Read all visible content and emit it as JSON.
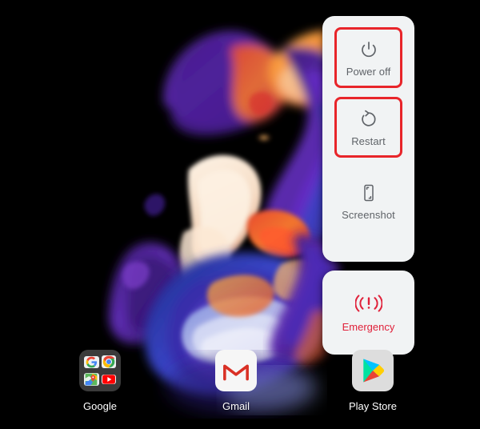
{
  "screen": {
    "background_color": "#000000",
    "wallpaper_name": "abstract-paint-swirl-wallpaper"
  },
  "power_menu": {
    "panel_background": "#f1f3f4",
    "highlight_color": "#e8252a",
    "label_color": "#5f6368",
    "items": [
      {
        "id": "power-off",
        "label": "Power off",
        "icon": "power-icon",
        "highlighted": true
      },
      {
        "id": "restart",
        "label": "Restart",
        "icon": "restart-icon",
        "highlighted": true
      },
      {
        "id": "screenshot",
        "label": "Screenshot",
        "icon": "screenshot-icon",
        "highlighted": false
      }
    ]
  },
  "emergency": {
    "label": "Emergency",
    "icon": "emergency-broadcast-icon",
    "text_color": "#e0213a",
    "card_background": "#f1f3f4"
  },
  "dock": {
    "apps": [
      {
        "id": "google-folder",
        "label": "Google",
        "icon": "google-folder-icon",
        "folder_items": [
          "google-g-icon",
          "chrome-icon",
          "maps-icon",
          "youtube-icon"
        ]
      },
      {
        "id": "gmail",
        "label": "Gmail",
        "icon": "gmail-icon"
      },
      {
        "id": "play-store",
        "label": "Play Store",
        "icon": "play-store-icon"
      }
    ],
    "label_color": "#ffffff"
  }
}
